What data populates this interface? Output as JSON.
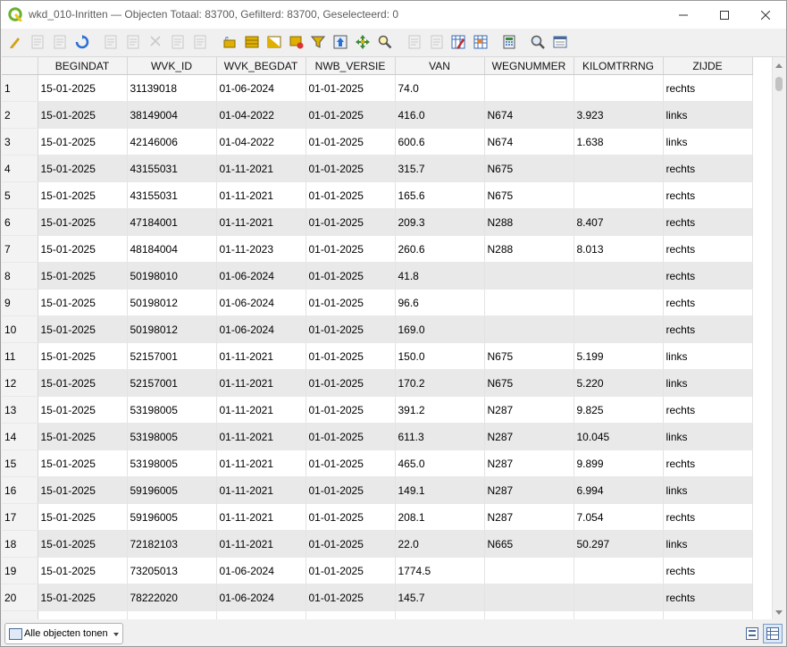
{
  "window": {
    "title": "wkd_010-Inritten — Objecten Totaal: 83700, Gefilterd: 83700, Geselecteerd: 0"
  },
  "toolbar": {
    "buttons": [
      {
        "name": "toggle-editing-icon",
        "color": "#d4a017"
      },
      {
        "name": "multi-edit-icon",
        "color": "#9a9a9a"
      },
      {
        "name": "save-edits-icon",
        "color": "#9a9a9a"
      },
      {
        "name": "reload-table-icon",
        "color": "#2a6fd1"
      },
      {
        "name": "add-feature-icon",
        "color": "#9a9a9a"
      },
      {
        "name": "delete-feature-icon",
        "color": "#9a9a9a"
      },
      {
        "name": "cut-icon",
        "color": "#9a9a9a"
      },
      {
        "name": "copy-icon",
        "color": "#9a9a9a"
      },
      {
        "name": "paste-icon",
        "color": "#9a9a9a"
      },
      {
        "name": "select-by-expression-icon",
        "color": "#e0b000"
      },
      {
        "name": "select-all-icon",
        "color": "#e0b000"
      },
      {
        "name": "invert-selection-icon",
        "color": "#e0b000"
      },
      {
        "name": "deselect-all-icon",
        "color": "#e0b000"
      },
      {
        "name": "filter-select-icon",
        "color": "#e0b000"
      },
      {
        "name": "move-selection-top-icon",
        "color": "#2a6fd1"
      },
      {
        "name": "pan-map-to-selection-icon",
        "color": "#3a8a3a"
      },
      {
        "name": "zoom-map-to-selection-icon",
        "color": "#e0b000"
      },
      {
        "name": "new-field-icon",
        "color": "#9a9a9a"
      },
      {
        "name": "delete-field-icon",
        "color": "#9a9a9a"
      },
      {
        "name": "organize-columns-icon",
        "color": "#3a6ab0"
      },
      {
        "name": "conditional-formatting-icon",
        "color": "#3a6ab0"
      },
      {
        "name": "field-calculator-icon",
        "color": "#3a6ab0"
      },
      {
        "name": "dock-table-icon",
        "color": "#4a6a9a"
      },
      {
        "name": "actions-icon",
        "color": "#4a6a9a"
      }
    ]
  },
  "table": {
    "columns": [
      "BEGINDAT",
      "WVK_ID",
      "WVK_BEGDAT",
      "NWB_VERSIE",
      "VAN",
      "WEGNUMMER",
      "KILOMTRRNG",
      "ZIJDE"
    ],
    "rows": [
      {
        "n": "1",
        "cells": [
          "15-01-2025",
          "31139018",
          "01-06-2024",
          "01-01-2025",
          "74.0",
          "",
          "",
          "rechts"
        ]
      },
      {
        "n": "2",
        "cells": [
          "15-01-2025",
          "38149004",
          "01-04-2022",
          "01-01-2025",
          "416.0",
          "N674",
          "3.923",
          "links"
        ]
      },
      {
        "n": "3",
        "cells": [
          "15-01-2025",
          "42146006",
          "01-04-2022",
          "01-01-2025",
          "600.6",
          "N674",
          "1.638",
          "links"
        ]
      },
      {
        "n": "4",
        "cells": [
          "15-01-2025",
          "43155031",
          "01-11-2021",
          "01-01-2025",
          "315.7",
          "N675",
          "",
          "rechts"
        ]
      },
      {
        "n": "5",
        "cells": [
          "15-01-2025",
          "43155031",
          "01-11-2021",
          "01-01-2025",
          "165.6",
          "N675",
          "",
          "rechts"
        ]
      },
      {
        "n": "6",
        "cells": [
          "15-01-2025",
          "47184001",
          "01-11-2021",
          "01-01-2025",
          "209.3",
          "N288",
          "8.407",
          "rechts"
        ]
      },
      {
        "n": "7",
        "cells": [
          "15-01-2025",
          "48184004",
          "01-11-2023",
          "01-01-2025",
          "260.6",
          "N288",
          "8.013",
          "rechts"
        ]
      },
      {
        "n": "8",
        "cells": [
          "15-01-2025",
          "50198010",
          "01-06-2024",
          "01-01-2025",
          "41.8",
          "",
          "",
          "rechts"
        ]
      },
      {
        "n": "9",
        "cells": [
          "15-01-2025",
          "50198012",
          "01-06-2024",
          "01-01-2025",
          "96.6",
          "",
          "",
          "rechts"
        ]
      },
      {
        "n": "10",
        "cells": [
          "15-01-2025",
          "50198012",
          "01-06-2024",
          "01-01-2025",
          "169.0",
          "",
          "",
          "rechts"
        ]
      },
      {
        "n": "11",
        "cells": [
          "15-01-2025",
          "52157001",
          "01-11-2021",
          "01-01-2025",
          "150.0",
          "N675",
          "5.199",
          "links"
        ]
      },
      {
        "n": "12",
        "cells": [
          "15-01-2025",
          "52157001",
          "01-11-2021",
          "01-01-2025",
          "170.2",
          "N675",
          "5.220",
          "links"
        ]
      },
      {
        "n": "13",
        "cells": [
          "15-01-2025",
          "53198005",
          "01-11-2021",
          "01-01-2025",
          "391.2",
          "N287",
          "9.825",
          "rechts"
        ]
      },
      {
        "n": "14",
        "cells": [
          "15-01-2025",
          "53198005",
          "01-11-2021",
          "01-01-2025",
          "611.3",
          "N287",
          "10.045",
          "links"
        ]
      },
      {
        "n": "15",
        "cells": [
          "15-01-2025",
          "53198005",
          "01-11-2021",
          "01-01-2025",
          "465.0",
          "N287",
          "9.899",
          "rechts"
        ]
      },
      {
        "n": "16",
        "cells": [
          "15-01-2025",
          "59196005",
          "01-11-2021",
          "01-01-2025",
          "149.1",
          "N287",
          "6.994",
          "links"
        ]
      },
      {
        "n": "17",
        "cells": [
          "15-01-2025",
          "59196005",
          "01-11-2021",
          "01-01-2025",
          "208.1",
          "N287",
          "7.054",
          "rechts"
        ]
      },
      {
        "n": "18",
        "cells": [
          "15-01-2025",
          "72182103",
          "01-11-2021",
          "01-01-2025",
          "22.0",
          "N665",
          "50.297",
          "links"
        ]
      },
      {
        "n": "19",
        "cells": [
          "15-01-2025",
          "73205013",
          "01-06-2024",
          "01-01-2025",
          "1774.5",
          "",
          "",
          "rechts"
        ]
      },
      {
        "n": "20",
        "cells": [
          "15-01-2025",
          "78222020",
          "01-06-2024",
          "01-01-2025",
          "145.7",
          "",
          "",
          "rechts"
        ]
      },
      {
        "n": "",
        "cells": [
          "",
          "",
          "",
          "",
          "",
          "",
          "",
          ""
        ]
      }
    ]
  },
  "statusbar": {
    "filter_label": "Alle objecten tonen"
  }
}
